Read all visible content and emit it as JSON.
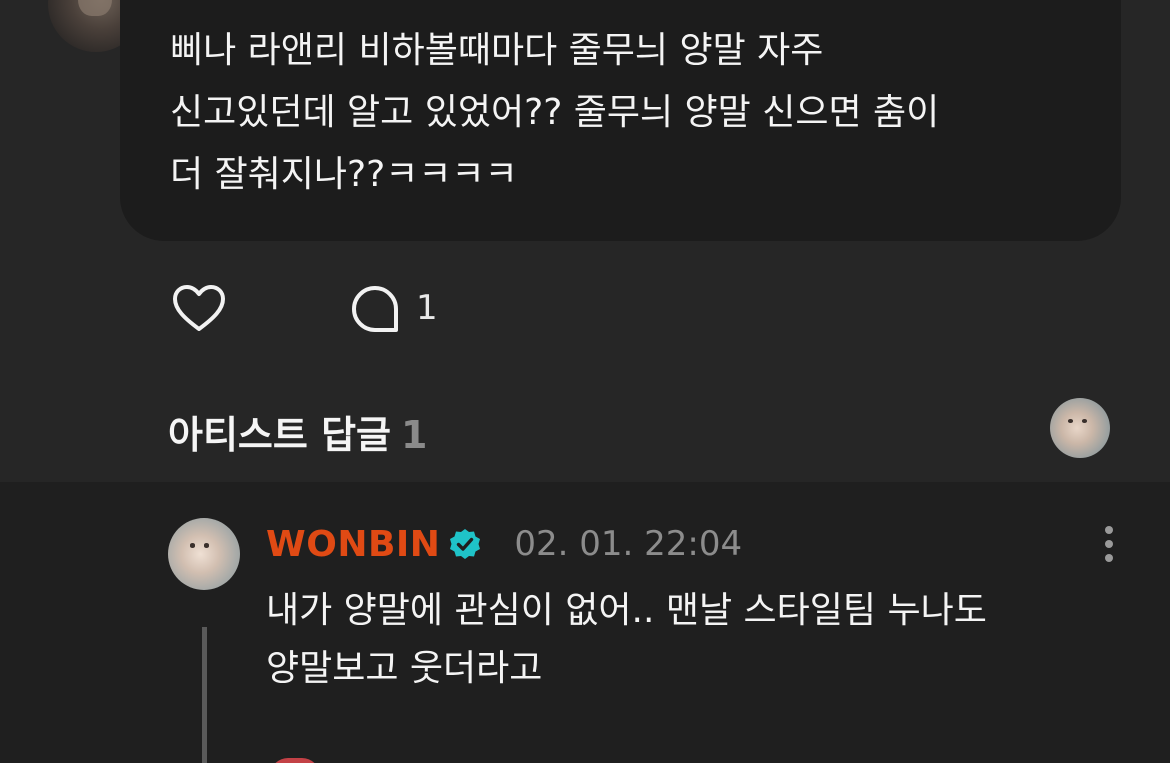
{
  "post": {
    "text": "삐나 라앤리 비하볼때마다 줄무늬 양말 자주\n신고있던데 알고 있었어?? 줄무늬 양말 신으면 춤이\n더 잘춰지나??ㅋㅋㅋㅋ",
    "comment_count": "1",
    "like_icon": "heart-outline-icon",
    "comment_icon": "speech-bubble-icon"
  },
  "artist_replies": {
    "title": "아티스트 답글",
    "count": "1"
  },
  "reply": {
    "author": "WONBIN",
    "verified_icon": "verified-badge-icon",
    "timestamp": "02. 01. 22:04",
    "text": "내가 양말에 관심이 없어.. 맨날 스타일팀 누나도\n양말보고 웃더라고",
    "more_icon": "vertical-ellipsis-icon"
  },
  "colors": {
    "background": "#262626",
    "bubble": "#1c1c1c",
    "reply_background": "#1f1f1f",
    "author_accent": "#e04a14",
    "verified": "#1fc3c8",
    "muted_text": "#8c8c8c"
  }
}
